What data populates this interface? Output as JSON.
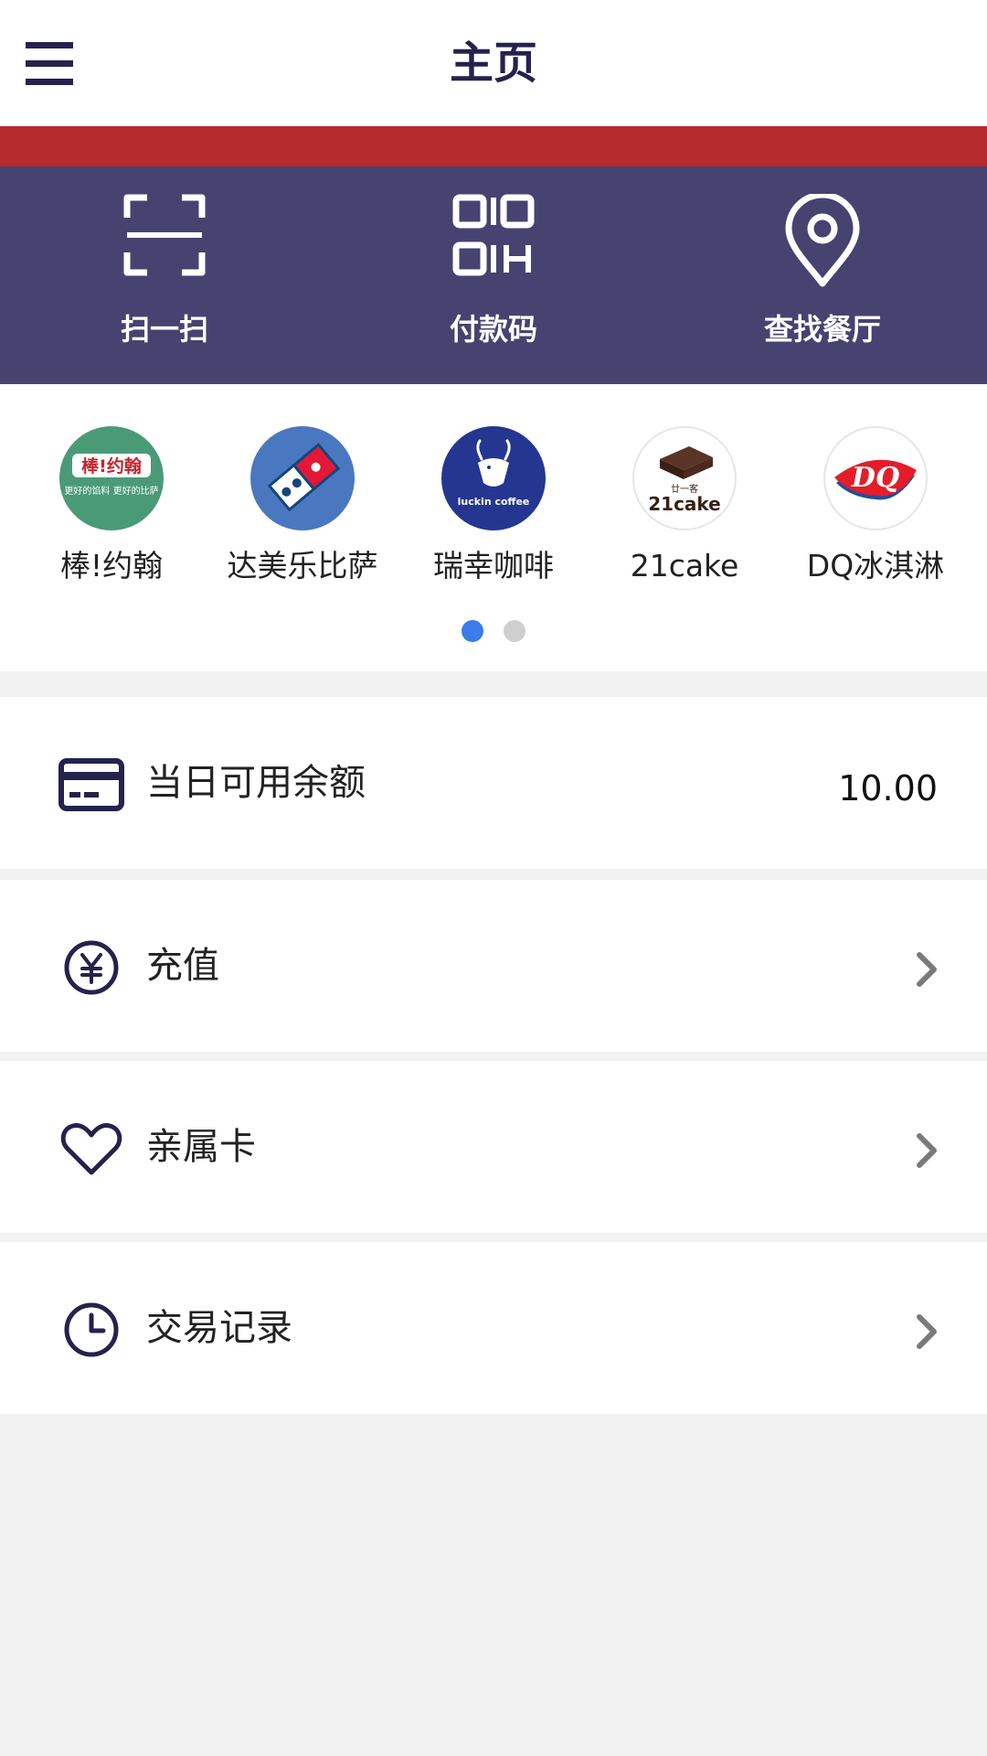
{
  "header": {
    "title": "主页",
    "menu_icon": "hamburger-menu-icon"
  },
  "colors": {
    "accent_navy": "#25224d",
    "action_bar": "#464371",
    "red_stripe": "#b52a2c",
    "dot_active": "#3b7bea",
    "dot_inactive": "#cfcfcf"
  },
  "actions": [
    {
      "label": "扫一扫",
      "icon": "scan-icon"
    },
    {
      "label": "付款码",
      "icon": "qr-code-icon"
    },
    {
      "label": "查找餐厅",
      "icon": "location-pin-icon"
    }
  ],
  "brands": [
    {
      "name": "棒!约翰",
      "logo": "papa-johns-logo",
      "logo_text": "棒!约翰",
      "logo_subtext": "更好的馅料 更好的比萨"
    },
    {
      "name": "达美乐比萨",
      "logo": "dominos-logo"
    },
    {
      "name": "瑞幸咖啡",
      "logo": "luckin-coffee-logo",
      "logo_text": "luckin coffee"
    },
    {
      "name": "21cake",
      "logo": "21cake-logo",
      "logo_text": "21cake",
      "logo_subtext": "廿一客"
    },
    {
      "name": "DQ冰淇淋",
      "logo": "dq-logo",
      "logo_text": "DQ"
    }
  ],
  "carousel": {
    "pages": 2,
    "active_index": 0
  },
  "rows": [
    {
      "label": "当日可用余额",
      "value": "10.00",
      "icon": "card-icon",
      "has_chevron": false
    },
    {
      "label": "充值",
      "icon": "yen-icon",
      "has_chevron": true
    },
    {
      "label": "亲属卡",
      "icon": "heart-icon",
      "has_chevron": true
    },
    {
      "label": "交易记录",
      "icon": "clock-icon",
      "has_chevron": true
    }
  ]
}
